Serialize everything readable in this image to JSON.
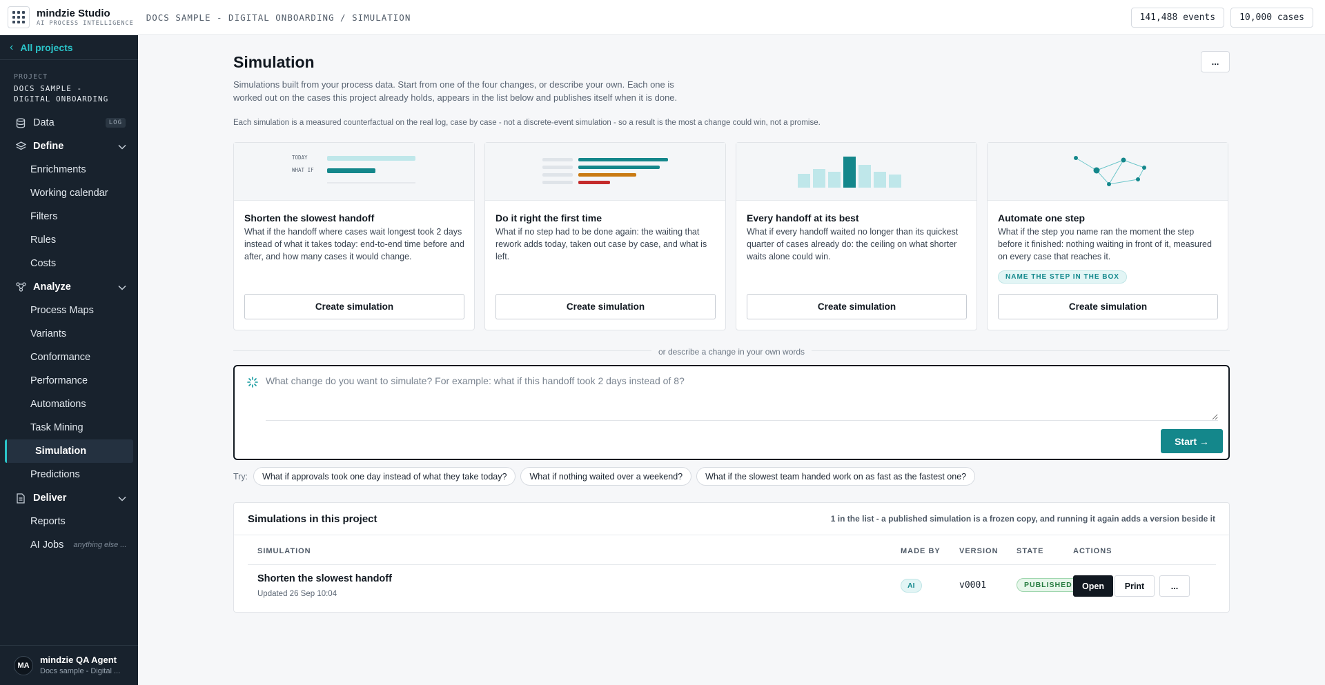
{
  "app": {
    "name": "mindzie Studio",
    "tagline": "AI PROCESS INTELLIGENCE",
    "breadcrumb": "DOCS SAMPLE - DIGITAL ONBOARDING / SIMULATION"
  },
  "stats": {
    "events": "141,488 events",
    "cases": "10,000 cases"
  },
  "sidebar": {
    "back": "All projects",
    "project_label": "PROJECT",
    "project_name": "DOCS SAMPLE - DIGITAL ONBOARDING",
    "data": {
      "label": "Data",
      "tag": "LOG"
    },
    "define": {
      "label": "Define",
      "items": [
        "Enrichments",
        "Working calendar",
        "Filters",
        "Rules",
        "Costs"
      ]
    },
    "analyze": {
      "label": "Analyze",
      "items": [
        "Process Maps",
        "Variants",
        "Conformance",
        "Performance",
        "Automations",
        "Task Mining",
        "Simulation",
        "Predictions"
      ]
    },
    "deliver": {
      "label": "Deliver",
      "items": [
        "Reports",
        "AI Jobs"
      ],
      "ai_hint": "anything else ..."
    },
    "user": {
      "initials": "MA",
      "name": "mindzie QA Agent",
      "project": "Docs sample - Digital ..."
    }
  },
  "page": {
    "title": "Simulation",
    "more": "...",
    "intro": "Simulations built from your process data. Start from one of the four changes, or describe your own. Each one is worked out on the cases this project already holds, appears in the list below and publishes itself when it is done.",
    "note": "Each simulation is a measured counterfactual on the real log, case by case - not a discrete-event simulation - so a result is the most a change could win, not a promise."
  },
  "cards": [
    {
      "title": "Shorten the slowest handoff",
      "desc": "What if the handoff where cases wait longest took 2 days instead of what it takes today: end-to-end time before and after, and how many cases it would change.",
      "button": "Create simulation",
      "vis_labels": [
        "TODAY",
        "WHAT IF"
      ]
    },
    {
      "title": "Do it right the first time",
      "desc": "What if no step had to be done again: the waiting that rework adds today, taken out case by case, and what is left.",
      "button": "Create simulation"
    },
    {
      "title": "Every handoff at its best",
      "desc": "What if every handoff waited no longer than its quickest quarter of cases already do: the ceiling on what shorter waits alone could win.",
      "button": "Create simulation"
    },
    {
      "title": "Automate one step",
      "desc": "What if the step you name ran the moment the step before it finished: nothing waiting in front of it, measured on every case that reaches it.",
      "badge": "NAME THE STEP IN THE BOX",
      "button": "Create simulation"
    }
  ],
  "divider": "or describe a change in your own words",
  "composer": {
    "placeholder": "What change do you want to simulate? For example: what if this handoff took 2 days instead of 8?",
    "value": "",
    "start": "Start →"
  },
  "try": {
    "label": "Try:",
    "chips": [
      "What if approvals took one day instead of what they take today?",
      "What if nothing waited over a weekend?",
      "What if the slowest team handed work on as fast as the fastest one?"
    ]
  },
  "list": {
    "title": "Simulations in this project",
    "meta": "1 in the list - a published simulation is a frozen copy, and running it again adds a version beside it",
    "headers": [
      "SIMULATION",
      "MADE BY",
      "VERSION",
      "STATE",
      "ACTIONS"
    ],
    "rows": [
      {
        "name": "Shorten the slowest handoff",
        "updated": "Updated 26 Sep 10:04",
        "made_by": "AI",
        "version": "v0001",
        "state": "PUBLISHED",
        "actions": [
          "Open",
          "Print",
          "..."
        ]
      }
    ]
  },
  "colors": {
    "accent": "#14878b",
    "sidebar_bg": "#18222d",
    "link": "#2bc4c9",
    "published": "#247a3e",
    "bar_orange": "#c97a12",
    "bar_red": "#c42b2b"
  }
}
